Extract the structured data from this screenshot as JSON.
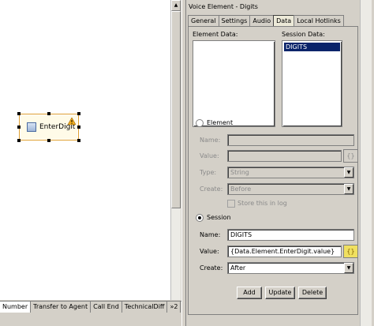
{
  "canvas": {
    "node_label": "EnterDigit"
  },
  "bottom_tabs": [
    {
      "label": "Number"
    },
    {
      "label": "Transfer to Agent"
    },
    {
      "label": "Call End"
    },
    {
      "label": "TechnicalDiff"
    },
    {
      "label": "»2"
    }
  ],
  "panel": {
    "title": "Voice Element - Digits",
    "tabs": [
      {
        "label": "General"
      },
      {
        "label": "Settings"
      },
      {
        "label": "Audio"
      },
      {
        "label": "Data"
      },
      {
        "label": "Local Hotlinks"
      }
    ],
    "element_data_label": "Element Data:",
    "session_data_label": "Session Data:",
    "session_data_items": [
      "DIGITS"
    ],
    "element_section": {
      "radio_label": "Element",
      "name_label": "Name:",
      "value_label": "Value:",
      "type_label": "Type:",
      "type_value": "String",
      "create_label": "Create:",
      "create_value": "Before",
      "store_log_label": "Store this in log"
    },
    "session_section": {
      "radio_label": "Session",
      "name_label": "Name:",
      "name_value": "DIGITS",
      "value_label": "Value:",
      "value_value": "{Data.Element.EnterDigit.value}",
      "create_label": "Create:",
      "create_value": "After"
    },
    "expr_icon": "{}",
    "buttons": {
      "add": "Add",
      "update": "Update",
      "delete": "Delete"
    }
  }
}
